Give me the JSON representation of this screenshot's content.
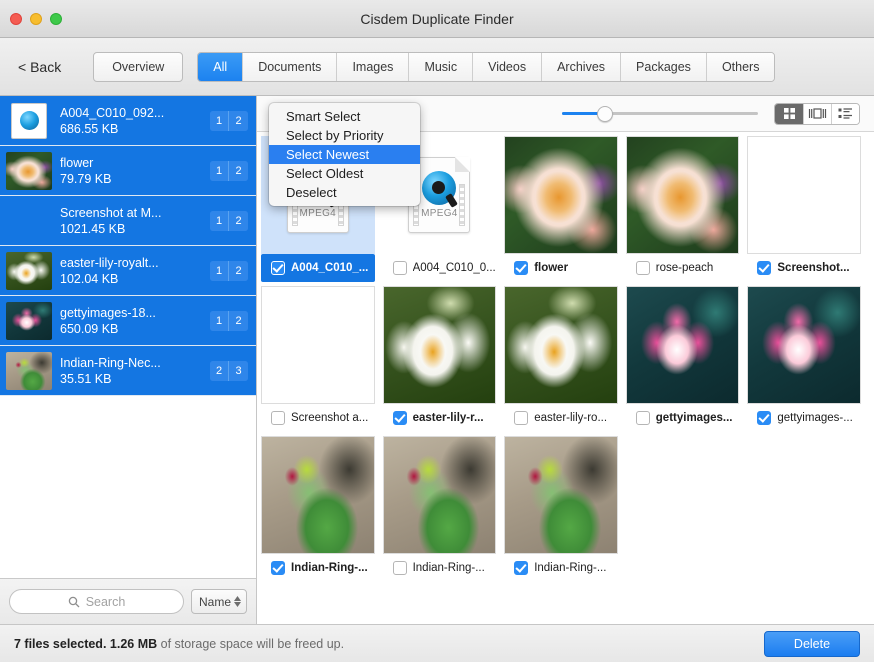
{
  "window": {
    "title": "Cisdem Duplicate Finder",
    "traffic_lights": [
      "close-button",
      "minimize-button",
      "maximize-button"
    ]
  },
  "toolbar": {
    "back_label": "< Back",
    "overview_label": "Overview",
    "tabs": [
      {
        "label": "All",
        "active": true
      },
      {
        "label": "Documents",
        "active": false
      },
      {
        "label": "Images",
        "active": false
      },
      {
        "label": "Music",
        "active": false
      },
      {
        "label": "Videos",
        "active": false
      },
      {
        "label": "Archives",
        "active": false
      },
      {
        "label": "Packages",
        "active": false
      },
      {
        "label": "Others",
        "active": false
      }
    ]
  },
  "context_menu": {
    "items": [
      {
        "label": "Smart Select",
        "highlighted": false
      },
      {
        "label": "Select by Priority",
        "highlighted": false
      },
      {
        "label": "Select Newest",
        "highlighted": true
      },
      {
        "label": "Select Oldest",
        "highlighted": false
      },
      {
        "label": "Deselect",
        "highlighted": false
      }
    ]
  },
  "sidebar": {
    "groups": [
      {
        "name": "A004_C010_092...",
        "size": "686.55 KB",
        "badge_left": "1",
        "badge_right": "2",
        "art": "mpeg"
      },
      {
        "name": "flower",
        "size": "79.79 KB",
        "badge_left": "1",
        "badge_right": "2",
        "art": "rose"
      },
      {
        "name": "Screenshot at M...",
        "size": "1021.45 KB",
        "badge_left": "1",
        "badge_right": "2",
        "art": "man"
      },
      {
        "name": "easter-lily-royalt...",
        "size": "102.04 KB",
        "badge_left": "1",
        "badge_right": "2",
        "art": "lily"
      },
      {
        "name": "gettyimages-18...",
        "size": "650.09 KB",
        "badge_left": "1",
        "badge_right": "2",
        "art": "lotus"
      },
      {
        "name": "Indian-Ring-Nec...",
        "size": "35.51 KB",
        "badge_left": "2",
        "badge_right": "3",
        "art": "parrot"
      }
    ],
    "search": {
      "placeholder": "Search",
      "value": ""
    },
    "sort": {
      "label": "Name"
    }
  },
  "right_toolbar": {
    "slider": {
      "value": 22,
      "min": 0,
      "max": 100
    },
    "views": [
      {
        "name": "grid-view",
        "active": true
      },
      {
        "name": "coverflow-view",
        "active": false
      },
      {
        "name": "list-view",
        "active": false
      }
    ]
  },
  "grid": {
    "rows": [
      [
        {
          "name": "A004_C010_...",
          "checked": true,
          "selected": true,
          "bold": true,
          "art": "mpegdoc"
        },
        {
          "name": "A004_C010_0...",
          "checked": false,
          "selected": false,
          "bold": false,
          "art": "mpegdoc"
        },
        {
          "name": "flower",
          "checked": true,
          "selected": false,
          "bold": true,
          "art": "rose"
        },
        {
          "name": "rose-peach",
          "checked": false,
          "selected": false,
          "bold": false,
          "art": "rose"
        },
        {
          "name": "Screenshot...",
          "checked": true,
          "selected": false,
          "bold": true,
          "art": "man"
        }
      ],
      [
        {
          "name": "Screenshot a...",
          "checked": false,
          "selected": false,
          "bold": false,
          "art": "man"
        },
        {
          "name": "easter-lily-r...",
          "checked": true,
          "selected": false,
          "bold": true,
          "art": "lily"
        },
        {
          "name": "easter-lily-ro...",
          "checked": false,
          "selected": false,
          "bold": false,
          "art": "lily"
        },
        {
          "name": "gettyimages...",
          "checked": false,
          "selected": false,
          "bold": true,
          "art": "lotus"
        },
        {
          "name": "gettyimages-...",
          "checked": true,
          "selected": false,
          "bold": false,
          "art": "lotus"
        }
      ],
      [
        {
          "name": "Indian-Ring-...",
          "checked": true,
          "selected": false,
          "bold": true,
          "art": "parrot"
        },
        {
          "name": "Indian-Ring-...",
          "checked": false,
          "selected": false,
          "bold": false,
          "art": "parrot"
        },
        {
          "name": "Indian-Ring-...",
          "checked": true,
          "selected": false,
          "bold": false,
          "art": "parrot"
        }
      ]
    ]
  },
  "statusbar": {
    "count_text": "7 files selected.",
    "size_text": "1.26 MB",
    "tail_text": "of storage space will be freed up.",
    "delete_label": "Delete"
  },
  "colors": {
    "accent_blue": "#1476e2",
    "checkbox_blue": "#2a8cf5",
    "menu_highlight": "#2a7ff0",
    "tab_active": "#1c82f0"
  }
}
